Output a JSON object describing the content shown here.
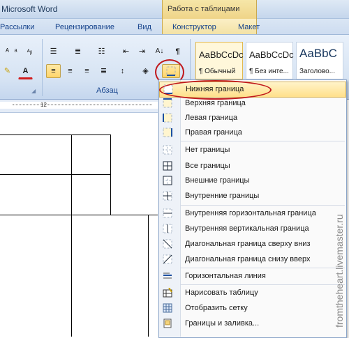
{
  "window": {
    "title": "Microsoft Word",
    "context_title": "Работа с таблицами"
  },
  "tabs": [
    "Рассылки",
    "Рецензирование",
    "Вид",
    "Конструктор",
    "Макет"
  ],
  "ribbon": {
    "group_label": "Абзац",
    "styles": [
      {
        "sample": "AaBbCcDc",
        "name": "¶ Обычный"
      },
      {
        "sample": "AaBbCcDc",
        "name": "¶ Без инте..."
      },
      {
        "sample": "AaBbC",
        "name": "Заголово..."
      }
    ]
  },
  "ruler": {
    "number": "12"
  },
  "border_menu": {
    "items": [
      {
        "label": "Нижняя граница",
        "icon": "bottom-border-icon"
      },
      {
        "label": "Верхняя граница",
        "icon": "top-border-icon"
      },
      {
        "label": "Левая граница",
        "icon": "left-border-icon"
      },
      {
        "label": "Правая граница",
        "icon": "right-border-icon"
      },
      {
        "label": "Нет границы",
        "icon": "no-border-icon"
      },
      {
        "label": "Все границы",
        "icon": "all-borders-icon"
      },
      {
        "label": "Внешние границы",
        "icon": "outside-borders-icon"
      },
      {
        "label": "Внутренние границы",
        "icon": "inside-borders-icon"
      },
      {
        "label": "Внутренняя горизонтальная граница",
        "icon": "inside-horizontal-border-icon"
      },
      {
        "label": "Внутренняя вертикальная граница",
        "icon": "inside-vertical-border-icon"
      },
      {
        "label": "Диагональная граница сверху вниз",
        "icon": "diagonal-down-border-icon"
      },
      {
        "label": "Диагональная граница снизу вверх",
        "icon": "diagonal-up-border-icon"
      },
      {
        "label": "Горизонтальная линия",
        "icon": "horizontal-line-icon"
      },
      {
        "label": "Нарисовать таблицу",
        "icon": "draw-table-icon"
      },
      {
        "label": "Отобразить сетку",
        "icon": "view-gridlines-icon"
      },
      {
        "label": "Границы и заливка...",
        "icon": "borders-shading-icon"
      }
    ]
  },
  "watermark": "fromtheheart.livemaster.ru"
}
